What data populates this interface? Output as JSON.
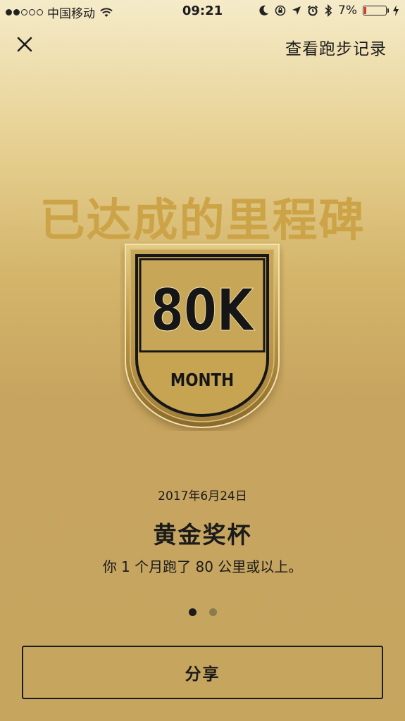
{
  "status_bar": {
    "carrier": "中国移动",
    "time": "09:21",
    "battery": "7%"
  },
  "nav": {
    "view_records": "查看跑步记录"
  },
  "heading": "已达成的里程碑",
  "badge": {
    "value": "80K",
    "unit": "MONTH"
  },
  "award": {
    "date": "2017年6月24日",
    "title": "黄金奖杯",
    "description": "你 1 个月跑了 80 公里或以上。"
  },
  "pager": {
    "total": 2,
    "current": 1
  },
  "share_label": "分享",
  "colors": {
    "gold": "#cca447",
    "text": "#1b1b1b",
    "battery_low": "#e2362b"
  }
}
